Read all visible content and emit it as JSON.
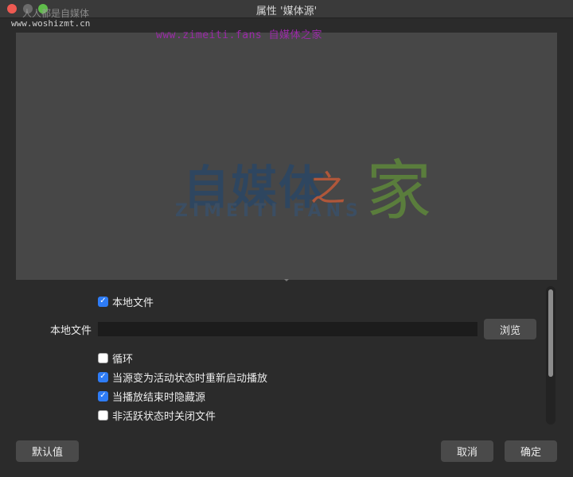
{
  "window": {
    "title": "属性 '媒体源'"
  },
  "watermarks": {
    "top": "人人都是自媒体",
    "site": "www.woshizmt.cn",
    "purple": "www.zimeiti.fans 自媒体之家"
  },
  "preview": {
    "logo_cn": "自媒体",
    "logo_zhi": "之",
    "logo_jia": "家",
    "logo_en": "ZIMEITI FANS"
  },
  "properties": {
    "local_file_checkbox": {
      "label": "本地文件",
      "checked": true
    },
    "local_file_field": {
      "label": "本地文件",
      "value": ""
    },
    "browse_button": "浏览",
    "loop": {
      "label": "循环",
      "checked": false
    },
    "restart_on_activate": {
      "label": "当源变为活动状态时重新启动播放",
      "checked": true
    },
    "hide_on_end": {
      "label": "当播放结束时隐藏源",
      "checked": true
    },
    "close_when_inactive": {
      "label": "非活跃状态时关闭文件",
      "checked": false
    }
  },
  "footer": {
    "defaults_button": "默认值",
    "cancel_button": "取消",
    "ok_button": "确定"
  },
  "colors": {
    "accent": "#2e7cf6",
    "background": "#2b2b2b",
    "preview": "#474747"
  }
}
